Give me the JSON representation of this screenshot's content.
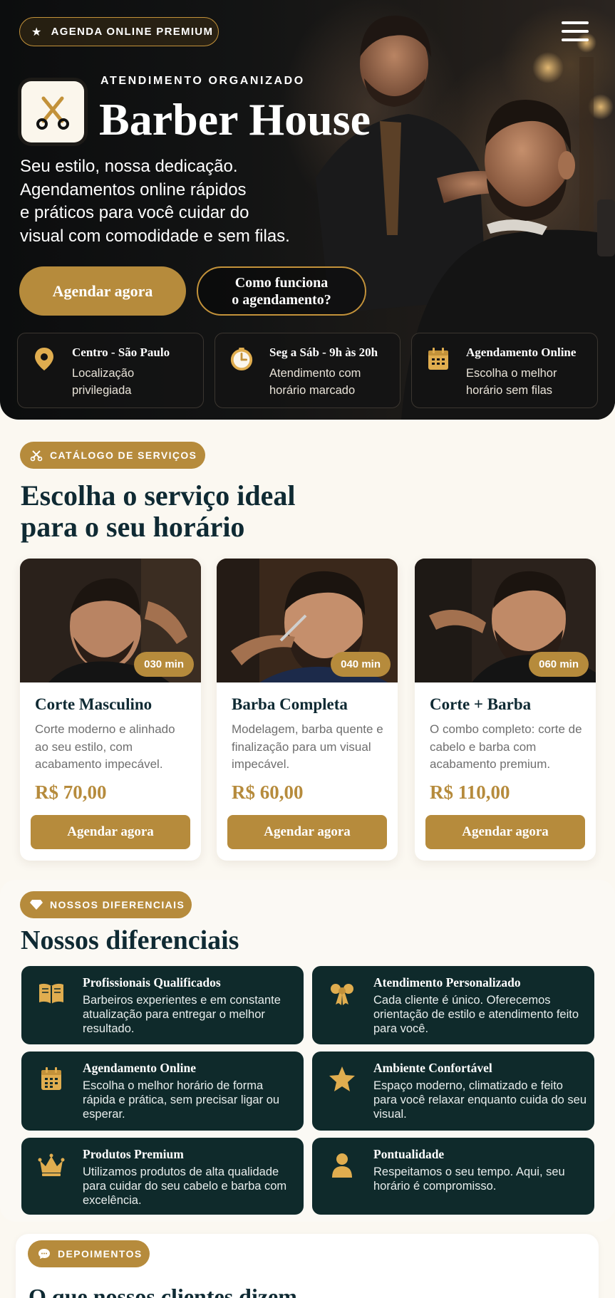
{
  "hero": {
    "badge": "AGENDA ONLINE PREMIUM",
    "eyebrow": "ATENDIMENTO ORGANIZADO",
    "title": "Barber House",
    "description": "Seu estilo, nossa dedicação.\nAgendamentos online rápidos\ne práticos para você cuidar do\nvisual com comodidade e sem filas.",
    "cta_primary": "Agendar agora",
    "cta_secondary": "Como funciona\no agendamento?",
    "info": [
      {
        "icon": "location-pin-icon",
        "title": "Centro - São Paulo",
        "subtitle": "Localização\nprivilegiada"
      },
      {
        "icon": "clock-icon",
        "title": "Seg a Sáb - 9h às 20h",
        "subtitle": "Atendimento com\nhorário marcado"
      },
      {
        "icon": "calendar-icon",
        "title": "Agendamento Online",
        "subtitle": "Escolha o melhor\nhorário sem filas"
      }
    ]
  },
  "catalog": {
    "pill": "CATÁLOGO DE SERVIÇOS",
    "title": "Escolha o serviço ideal\npara o seu horário",
    "services": [
      {
        "name": "Corte Masculino",
        "duration": "030 min",
        "description": "Corte moderno e alinhado ao seu estilo, com acabamento impecável.",
        "price": "R$ 70,00",
        "button": "Agendar agora"
      },
      {
        "name": "Barba Completa",
        "duration": "040 min",
        "description": "Modelagem, barba quente e finalização para um visual impecável.",
        "price": "R$ 60,00",
        "button": "Agendar agora"
      },
      {
        "name": "Corte + Barba",
        "duration": "060 min",
        "description": "O combo completo: corte de cabelo e barba com acabamento premium.",
        "price": "R$ 110,00",
        "button": "Agendar agora"
      }
    ]
  },
  "differentials": {
    "pill": "NOSSOS DIFERENCIAIS",
    "title": "Nossos diferenciais",
    "items": [
      {
        "icon": "book-icon",
        "title": "Profissionais Qualificados",
        "text": "Barbeiros experientes e em constante atualização para entregar o melhor resultado."
      },
      {
        "icon": "ribbon-icon",
        "title": "Atendimento Personalizado",
        "text": "Cada cliente é único. Oferecemos orientação de estilo e atendimento feito para você."
      },
      {
        "icon": "calendar-icon",
        "title": "Agendamento Online",
        "text": "Escolha o melhor horário de forma rápida e prática, sem precisar ligar ou esperar."
      },
      {
        "icon": "star-icon",
        "title": "Ambiente Confortável",
        "text": "Espaço moderno, climatizado e feito para você relaxar enquanto cuida do seu visual."
      },
      {
        "icon": "crown-icon",
        "title": "Produtos Premium",
        "text": "Utilizamos produtos de alta qualidade para cuidar do seu cabelo e barba com excelência."
      },
      {
        "icon": "person-icon",
        "title": "Pontualidade",
        "text": "Respeitamos o seu tempo. Aqui, seu horário é compromisso."
      }
    ]
  },
  "testimonials": {
    "pill": "DEPOIMENTOS",
    "title": "O que nossos clientes dizem"
  },
  "colors": {
    "accent": "#b68b3c",
    "dark_teal": "#0f2a2b",
    "heading": "#0f2a33",
    "background": "#fbf8f1"
  }
}
